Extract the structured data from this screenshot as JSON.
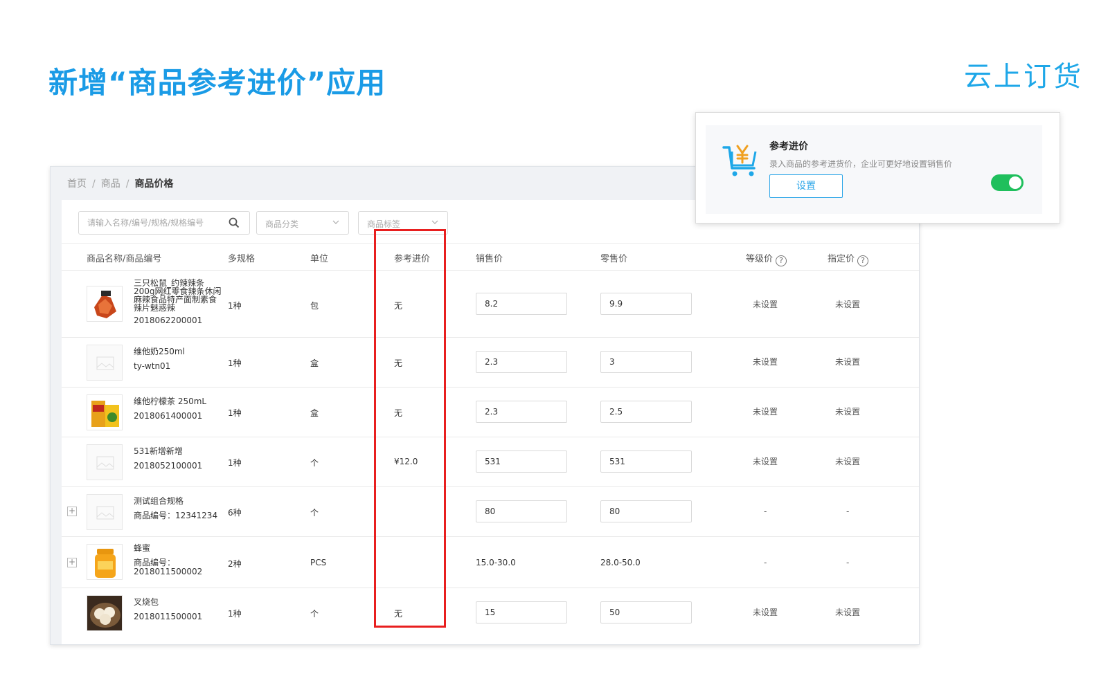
{
  "slide": {
    "title": "新增“商品参考进价”应用",
    "brand": "云上订货"
  },
  "breadcrumb": [
    "首页",
    "商品",
    "商品价格"
  ],
  "filters": {
    "search_placeholder": "请输入名称/编号/规格/规格编号",
    "category_placeholder": "商品分类",
    "tag_placeholder": "商品标签"
  },
  "table": {
    "columns": [
      "商品名称/商品编号",
      "多规格",
      "单位",
      "参考进价",
      "销售价",
      "零售价",
      "等级价",
      "指定价"
    ],
    "rows": [
      {
        "name": "三只松鼠_约辣辣条200g网红零食辣条休闲麻辣食品特产面制素食辣片魅惑辣",
        "code": "2018062200001",
        "spec": "1种",
        "unit": "包",
        "ref_price": "无",
        "sale_price": "8.2",
        "retail_price": "9.9",
        "level_price": "未设置",
        "assigned_price": "未设置"
      },
      {
        "name": "维他奶250ml",
        "code": "ty-wtn01",
        "spec": "1种",
        "unit": "盒",
        "ref_price": "无",
        "sale_price": "2.3",
        "retail_price": "3",
        "level_price": "未设置",
        "assigned_price": "未设置"
      },
      {
        "name": "维他柠檬茶 250mL",
        "code": "2018061400001",
        "spec": "1种",
        "unit": "盒",
        "ref_price": "无",
        "sale_price": "2.3",
        "retail_price": "2.5",
        "level_price": "未设置",
        "assigned_price": "未设置"
      },
      {
        "name": "531新增新增",
        "code": "2018052100001",
        "spec": "1种",
        "unit": "个",
        "ref_price": "¥12.0",
        "sale_price": "531",
        "retail_price": "531",
        "level_price": "未设置",
        "assigned_price": "未设置"
      },
      {
        "name": "测试组合规格",
        "code": "商品编号：12341234",
        "spec": "6种",
        "unit": "个",
        "ref_price": "",
        "sale_price": "80",
        "retail_price": "80",
        "level_price": "-",
        "assigned_price": "-"
      },
      {
        "name": "蜂蜜",
        "code": "商品编号：2018011500002",
        "spec": "2种",
        "unit": "PCS",
        "ref_price": "",
        "sale_price": "15.0-30.0",
        "retail_price": "28.0-50.0",
        "level_price": "-",
        "assigned_price": "-"
      },
      {
        "name": "叉烧包",
        "code": "2018011500001",
        "spec": "1种",
        "unit": "个",
        "ref_price": "无",
        "sale_price": "15",
        "retail_price": "50",
        "level_price": "未设置",
        "assigned_price": "未设置"
      }
    ]
  },
  "popup": {
    "title": "参考进价",
    "description": "录入商品的参考进货价，企业可更好地设置销售价",
    "button_label": "设置",
    "toggle_on": true,
    "icon": "shopping-cart-yen-icon"
  },
  "colors": {
    "title_blue": "#1a9be6",
    "highlight_red": "#e81f1f",
    "toggle_green": "#1fbf5c",
    "button_blue": "#2fa7e8"
  }
}
